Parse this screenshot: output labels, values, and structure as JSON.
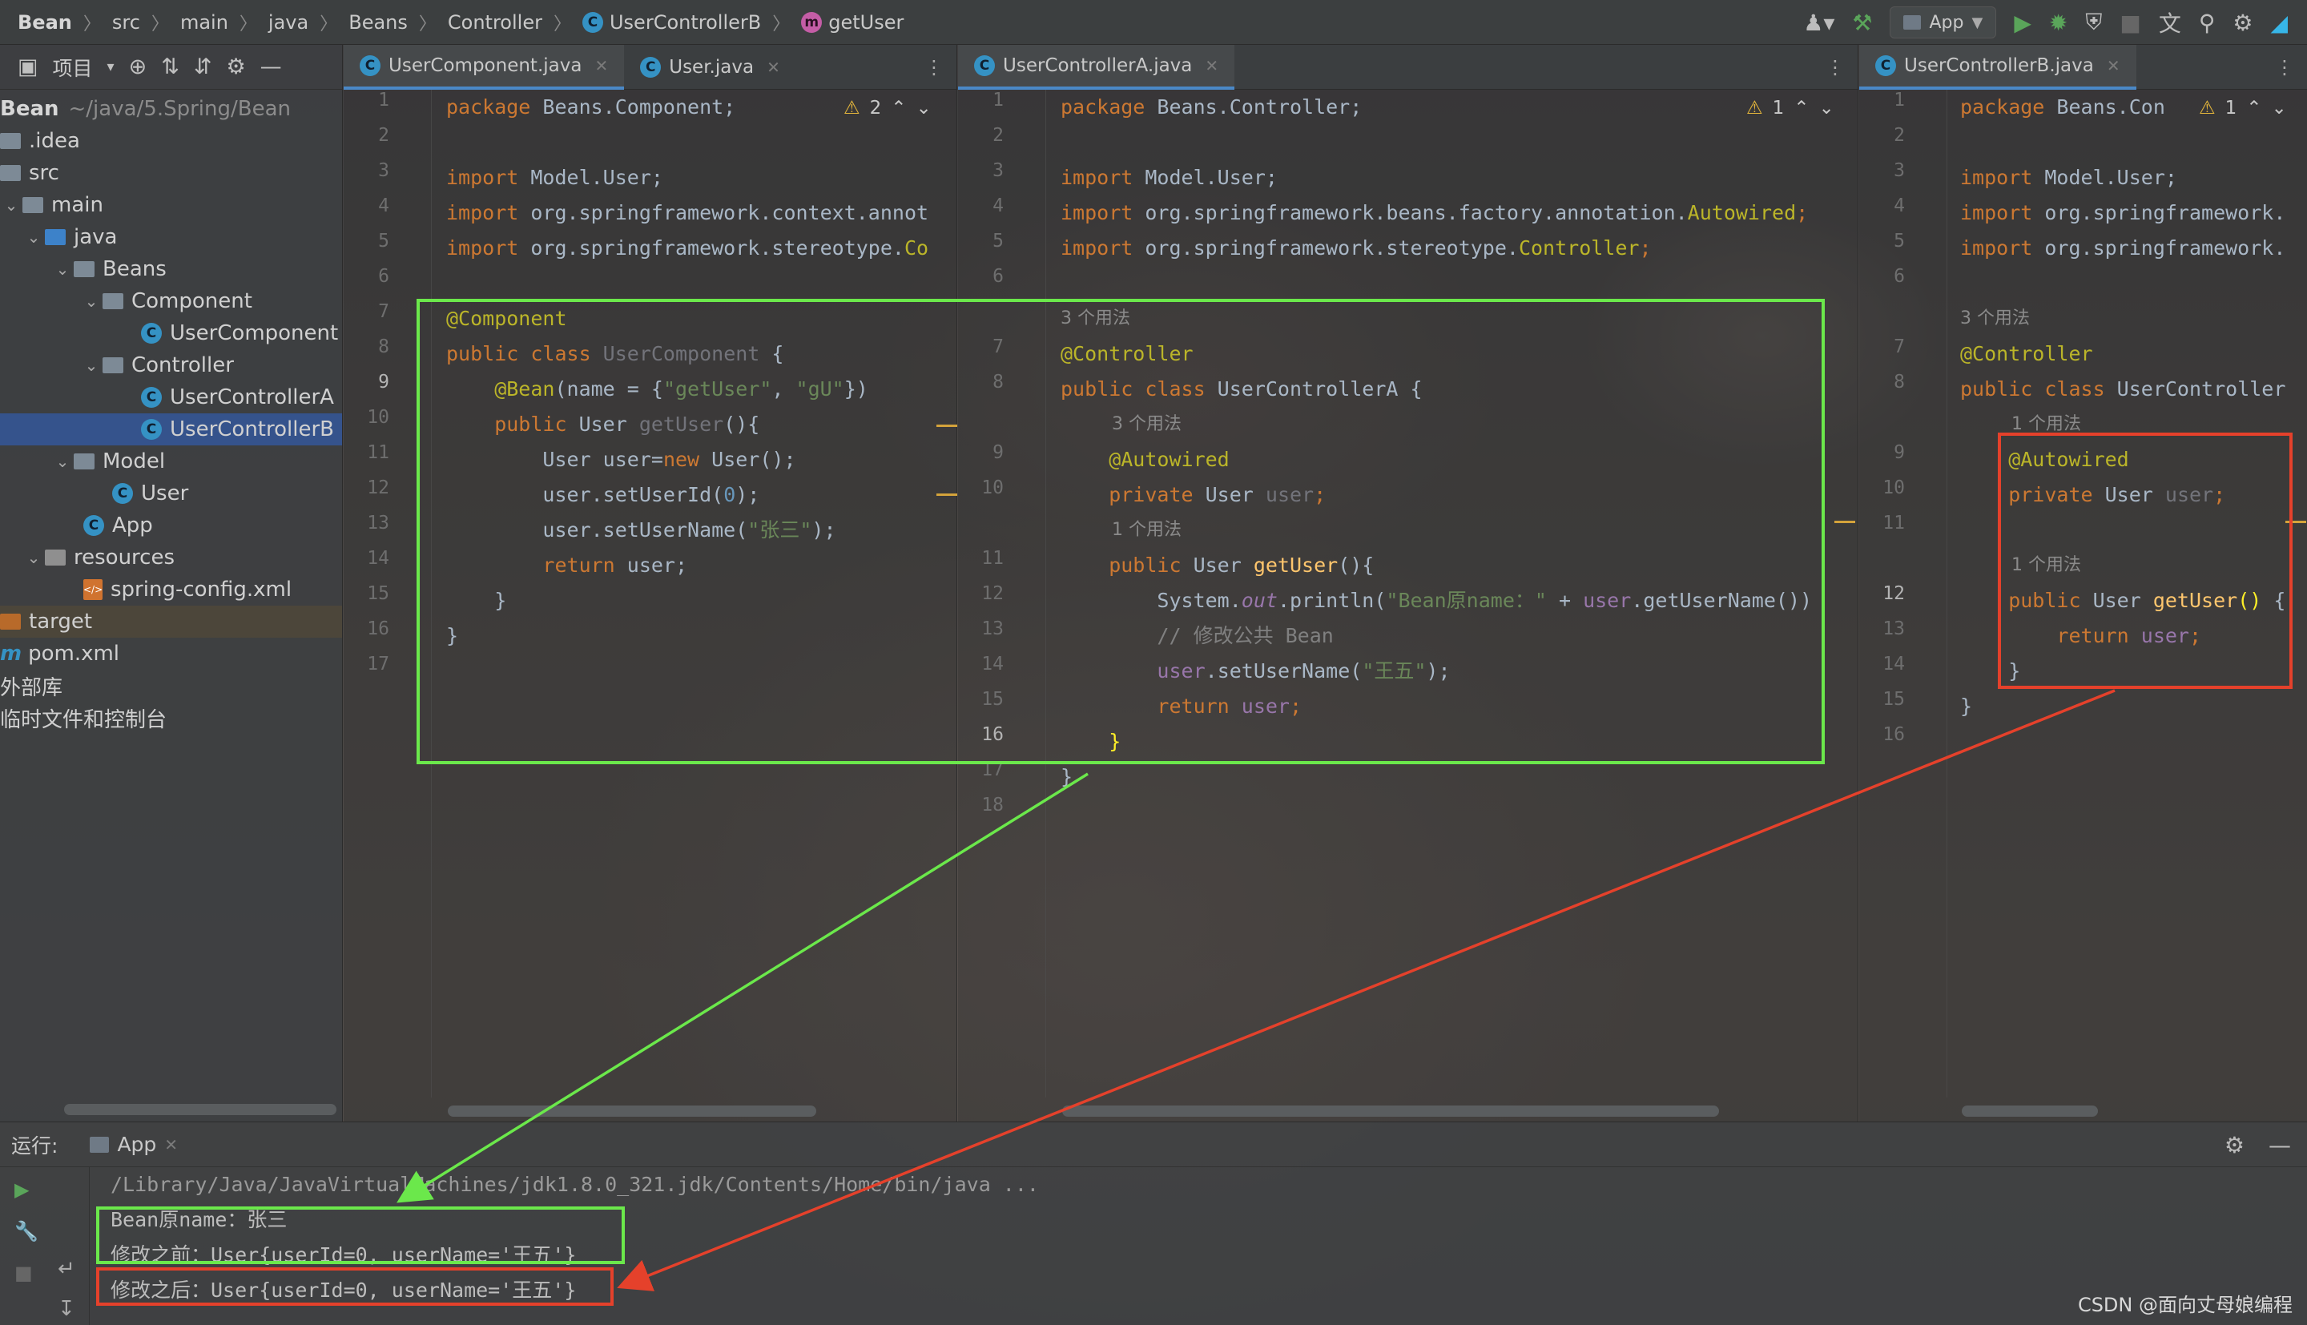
{
  "navbar": {
    "crumbs": [
      "Bean",
      "src",
      "main",
      "java",
      "Beans",
      "Controller",
      "UserControllerB",
      "getUser"
    ],
    "run_config": "App"
  },
  "project": {
    "title": "项目",
    "root_name": "Bean",
    "root_path": "~/java/5.Spring/Bean",
    "items": [
      {
        "label": ".idea"
      },
      {
        "label": "src"
      },
      {
        "label": "main"
      },
      {
        "label": "java"
      },
      {
        "label": "Beans"
      },
      {
        "label": "Component"
      },
      {
        "label": "UserComponent"
      },
      {
        "label": "Controller"
      },
      {
        "label": "UserControllerA"
      },
      {
        "label": "UserControllerB"
      },
      {
        "label": "Model"
      },
      {
        "label": "User"
      },
      {
        "label": "App"
      },
      {
        "label": "resources"
      },
      {
        "label": "spring-config.xml"
      },
      {
        "label": "target"
      },
      {
        "label": "pom.xml"
      },
      {
        "label": "外部库"
      },
      {
        "label": "临时文件和控制台"
      }
    ]
  },
  "editor1": {
    "tabs": [
      {
        "label": "UserComponent.java"
      },
      {
        "label": "User.java"
      }
    ],
    "warning_count": "2",
    "line_numbers": [
      "1",
      "2",
      "3",
      "4",
      "5",
      "6",
      "7",
      "8",
      "9",
      "10",
      "11",
      "12",
      "13",
      "14",
      "15",
      "16",
      "17"
    ],
    "code": {
      "l1a": "package",
      "l1b": " Beans.Component;",
      "l3a": "import",
      "l3b": " Model.User;",
      "l4a": "import",
      "l4b": " org.springframework.context.annot",
      "l5a": "import",
      "l5b": " org.springframework.stereotype.",
      "l5c": "Co",
      "l7": "@Component",
      "l8a": "public class",
      "l8b": " UserComponent",
      "l8c": " {",
      "l9a": "    @Bean",
      "l9b": "(name = {",
      "l9c": "\"getUser\"",
      "l9d": ", ",
      "l9e": "\"gU\"",
      "l9f": "})",
      "l10a": "    public",
      "l10b": " User ",
      "l10c": "getUser",
      "l10d": "(){",
      "l11a": "        User user=",
      "l11b": "new",
      "l11c": " User();",
      "l12a": "        user.setUserId(",
      "l12b": "0",
      "l12c": ");",
      "l13a": "        user.setUserName(",
      "l13b": "\"张三\"",
      "l13c": ");",
      "l14a": "        return",
      "l14b": " user;",
      "l15": "    }",
      "l16": "}"
    }
  },
  "editor2": {
    "tabs": [
      {
        "label": "UserControllerA.java"
      }
    ],
    "warning_count": "1",
    "line_numbers": [
      "1",
      "2",
      "3",
      "4",
      "5",
      "6",
      "",
      "7",
      "8",
      "",
      "9",
      "10",
      "",
      "11",
      "12",
      "13",
      "14",
      "15",
      "16",
      "17",
      "18"
    ],
    "code": {
      "l1a": "package",
      "l1b": " Beans.Controller;",
      "l3a": "import",
      "l3b": " Model.User;",
      "l4a": "import",
      "l4b": " org.springframework.beans.factory.annotation.",
      "l4c": "Autowired",
      "l4d": ";",
      "l5a": "import",
      "l5b": " org.springframework.stereotype.",
      "l5c": "Controller",
      "l5d": ";",
      "u1": "3 个用法",
      "l7": "@Controller",
      "l8a": "public class",
      "l8b": " UserControllerA {",
      "u2": "3 个用法",
      "l9": "    @Autowired",
      "l10a": "    private",
      "l10b": " User ",
      "l10c": "user",
      "l10d": ";",
      "u3": "1 个用法",
      "l11a": "    public",
      "l11b": " User ",
      "l11c": "getUser",
      "l11d": "(){",
      "l12a": "        System.",
      "l12b": "out",
      "l12c": ".println(",
      "l12d": "\"Bean原name：\"",
      "l12e": " + ",
      "l12f": "user",
      "l12g": ".getUserName())",
      "l13": "        // 修改公共 Bean",
      "l14a": "        ",
      "l14b": "user",
      "l14c": ".setUserName(",
      "l14d": "\"王五\"",
      "l14e": ");",
      "l15a": "        return",
      "l15b": " user",
      "l15c": ";",
      "l16": "    }",
      "l17": "}"
    }
  },
  "editor3": {
    "tabs": [
      {
        "label": "UserControllerB.java"
      }
    ],
    "warning_count": "1",
    "line_numbers": [
      "1",
      "2",
      "3",
      "4",
      "5",
      "6",
      "",
      "7",
      "8",
      "",
      "9",
      "10",
      "11",
      "",
      "12",
      "13",
      "14",
      "15",
      "16"
    ],
    "code": {
      "l1a": "package",
      "l1b": " Beans.Con",
      "l3a": "import",
      "l3b": " Model.User;",
      "l4a": "import",
      "l4b": " org.springframework.",
      "l5a": "import",
      "l5b": " org.springframework.",
      "u1": "3 个用法",
      "l7": "@Controller",
      "l8a": "public class",
      "l8b": " UserController",
      "u2": "1 个用法",
      "l9": "    @Autowired",
      "l10a": "    private",
      "l10b": " User ",
      "l10c": "user",
      "l10d": ";",
      "u3": "1 个用法",
      "l12a": "    public",
      "l12b": " User ",
      "l12c": "getUser",
      "l12d": "()",
      "l12e": " {",
      "l13a": "        return",
      "l13b": " user",
      "l13c": ";",
      "l14": "    }",
      "l15": "}"
    }
  },
  "run": {
    "label": "运行:",
    "tab": "App",
    "lines": [
      "/Library/Java/JavaVirtualMachines/jdk1.8.0_321.jdk/Contents/Home/bin/java ...",
      "Bean原name：张三",
      "修改之前：User{userId=0, userName='王五'}",
      "修改之后：User{userId=0, userName='王五'}"
    ]
  },
  "watermark": "CSDN @面向丈母娘编程",
  "colors": {
    "highlight_green": "#6be84b",
    "highlight_red": "#e5412b",
    "keyword": "#cc7832",
    "annotation": "#bbb529",
    "string": "#6a8759"
  }
}
